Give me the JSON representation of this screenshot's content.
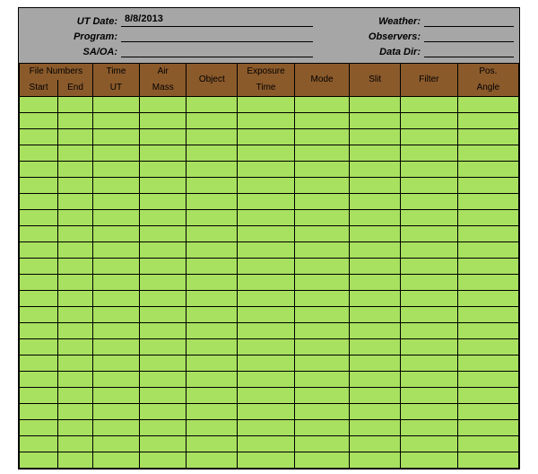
{
  "header": {
    "left_labels": [
      "UT Date:",
      "Program:",
      "SA/OA:"
    ],
    "right_labels": [
      "Weather:",
      "Observers:",
      "Data Dir:"
    ],
    "ut_date": "8/8/2013",
    "program": "",
    "sa_oa": "",
    "weather": "",
    "observers": "",
    "data_dir": ""
  },
  "columns": {
    "file_numbers": "File Numbers",
    "start": "Start",
    "end": "End",
    "time_ut": "Time UT",
    "air_mass": "Air Mass",
    "object": "Object",
    "exposure_time": "Exposure Time",
    "mode": "Mode",
    "slit": "Slit",
    "filter": "Filter",
    "pos_angle": "Pos. Angle"
  },
  "row_count": 23
}
